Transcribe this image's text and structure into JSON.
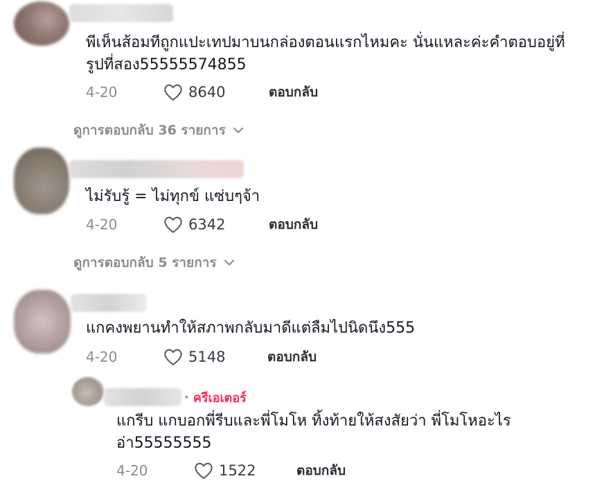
{
  "comments": [
    {
      "text": "พีเห็นส้อมทีถูกแปะเทปมาบนกล่องตอนแรกไหมคะ นั่นแหละค่ะคำตอบอยู่ที่\nรูปที่สอง55555574855",
      "date": "4-20",
      "likes": "8640",
      "reply_label": "ตอบกลับ",
      "view_replies": "ดูการตอบกลับ 36 รายการ"
    },
    {
      "text": "ไม่รับรู้ = ไม่ทุกข์ แซ่บๆจ้า",
      "date": "4-20",
      "likes": "6342",
      "reply_label": "ตอบกลับ",
      "view_replies": "ดูการตอบกลับ 5 รายการ"
    },
    {
      "text": "แกคงพยานทำให้สภาพกลับมาดีแต่ลืมไปนิดนึง555",
      "date": "4-20",
      "likes": "5148",
      "reply_label": "ตอบกลับ"
    }
  ],
  "reply": {
    "creator_badge": "ครีเอเตอร์",
    "separator": "·",
    "text": "แกรีบ แกบอกพี่รีบและพี่โมโห ทิ้งท้ายให้สงสัยว่า พี่โมโหอะไร\nอ่า55555555",
    "date": "4-20",
    "likes": "1522",
    "reply_label": "ตอบกลับ"
  },
  "colors": {
    "accent_creator": "#fe2c55",
    "muted": "#8a8b91",
    "text": "#161823"
  },
  "icons": [
    "heart-outline-icon",
    "chevron-down-icon"
  ]
}
